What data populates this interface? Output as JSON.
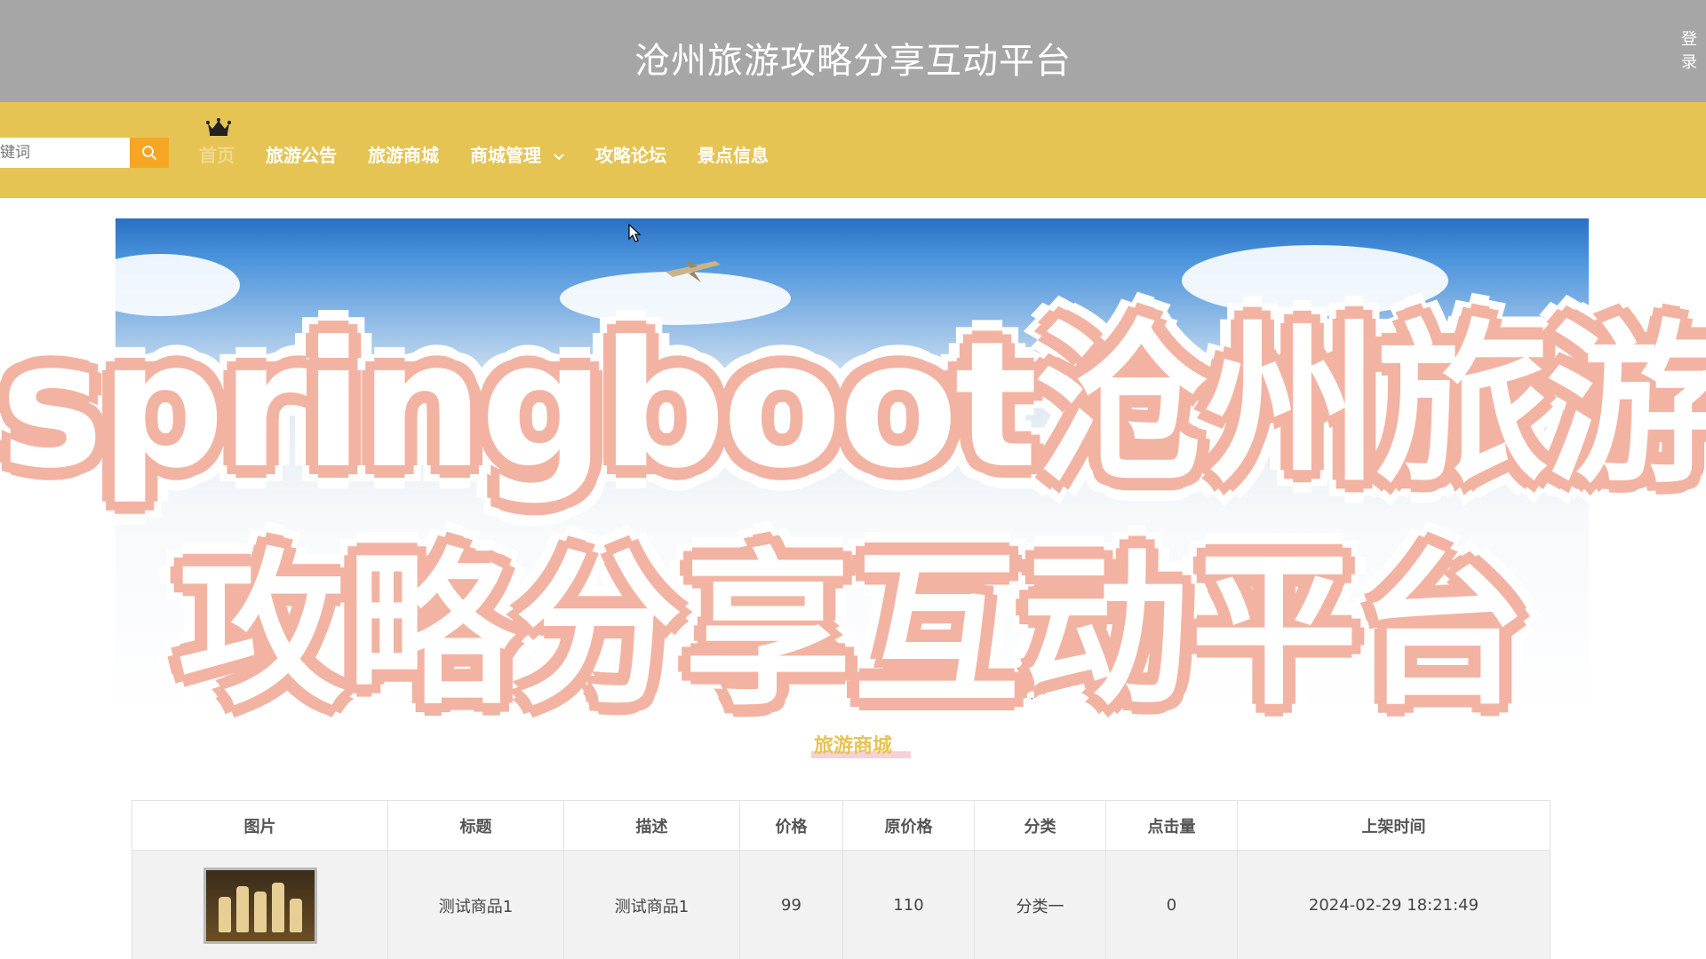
{
  "header": {
    "site_title": "沧州旅游攻略分享互动平台",
    "login_label": "登录"
  },
  "nav": {
    "search_placeholder": "键词",
    "items": [
      {
        "label": "首页"
      },
      {
        "label": "旅游公告"
      },
      {
        "label": "旅游商城"
      },
      {
        "label": "商城管理"
      },
      {
        "label": "攻略论坛"
      },
      {
        "label": "景点信息"
      }
    ]
  },
  "overlay": {
    "line1": "springboot沧州旅游",
    "line2": "攻略分享互动平台"
  },
  "section": {
    "title": "旅游商城"
  },
  "table": {
    "headers": [
      "图片",
      "标题",
      "描述",
      "价格",
      "原价格",
      "分类",
      "点击量",
      "上架时间"
    ],
    "rows": [
      {
        "title": "测试商品1",
        "description": "测试商品1",
        "price": "99",
        "original_price": "110",
        "category": "分类一",
        "clicks": "0",
        "listed_time": "2024-02-29 18:21:49"
      }
    ]
  },
  "colors": {
    "title_bar": "#a6a6a6",
    "nav_bar": "#e5c454",
    "search_button": "#f5a623"
  }
}
